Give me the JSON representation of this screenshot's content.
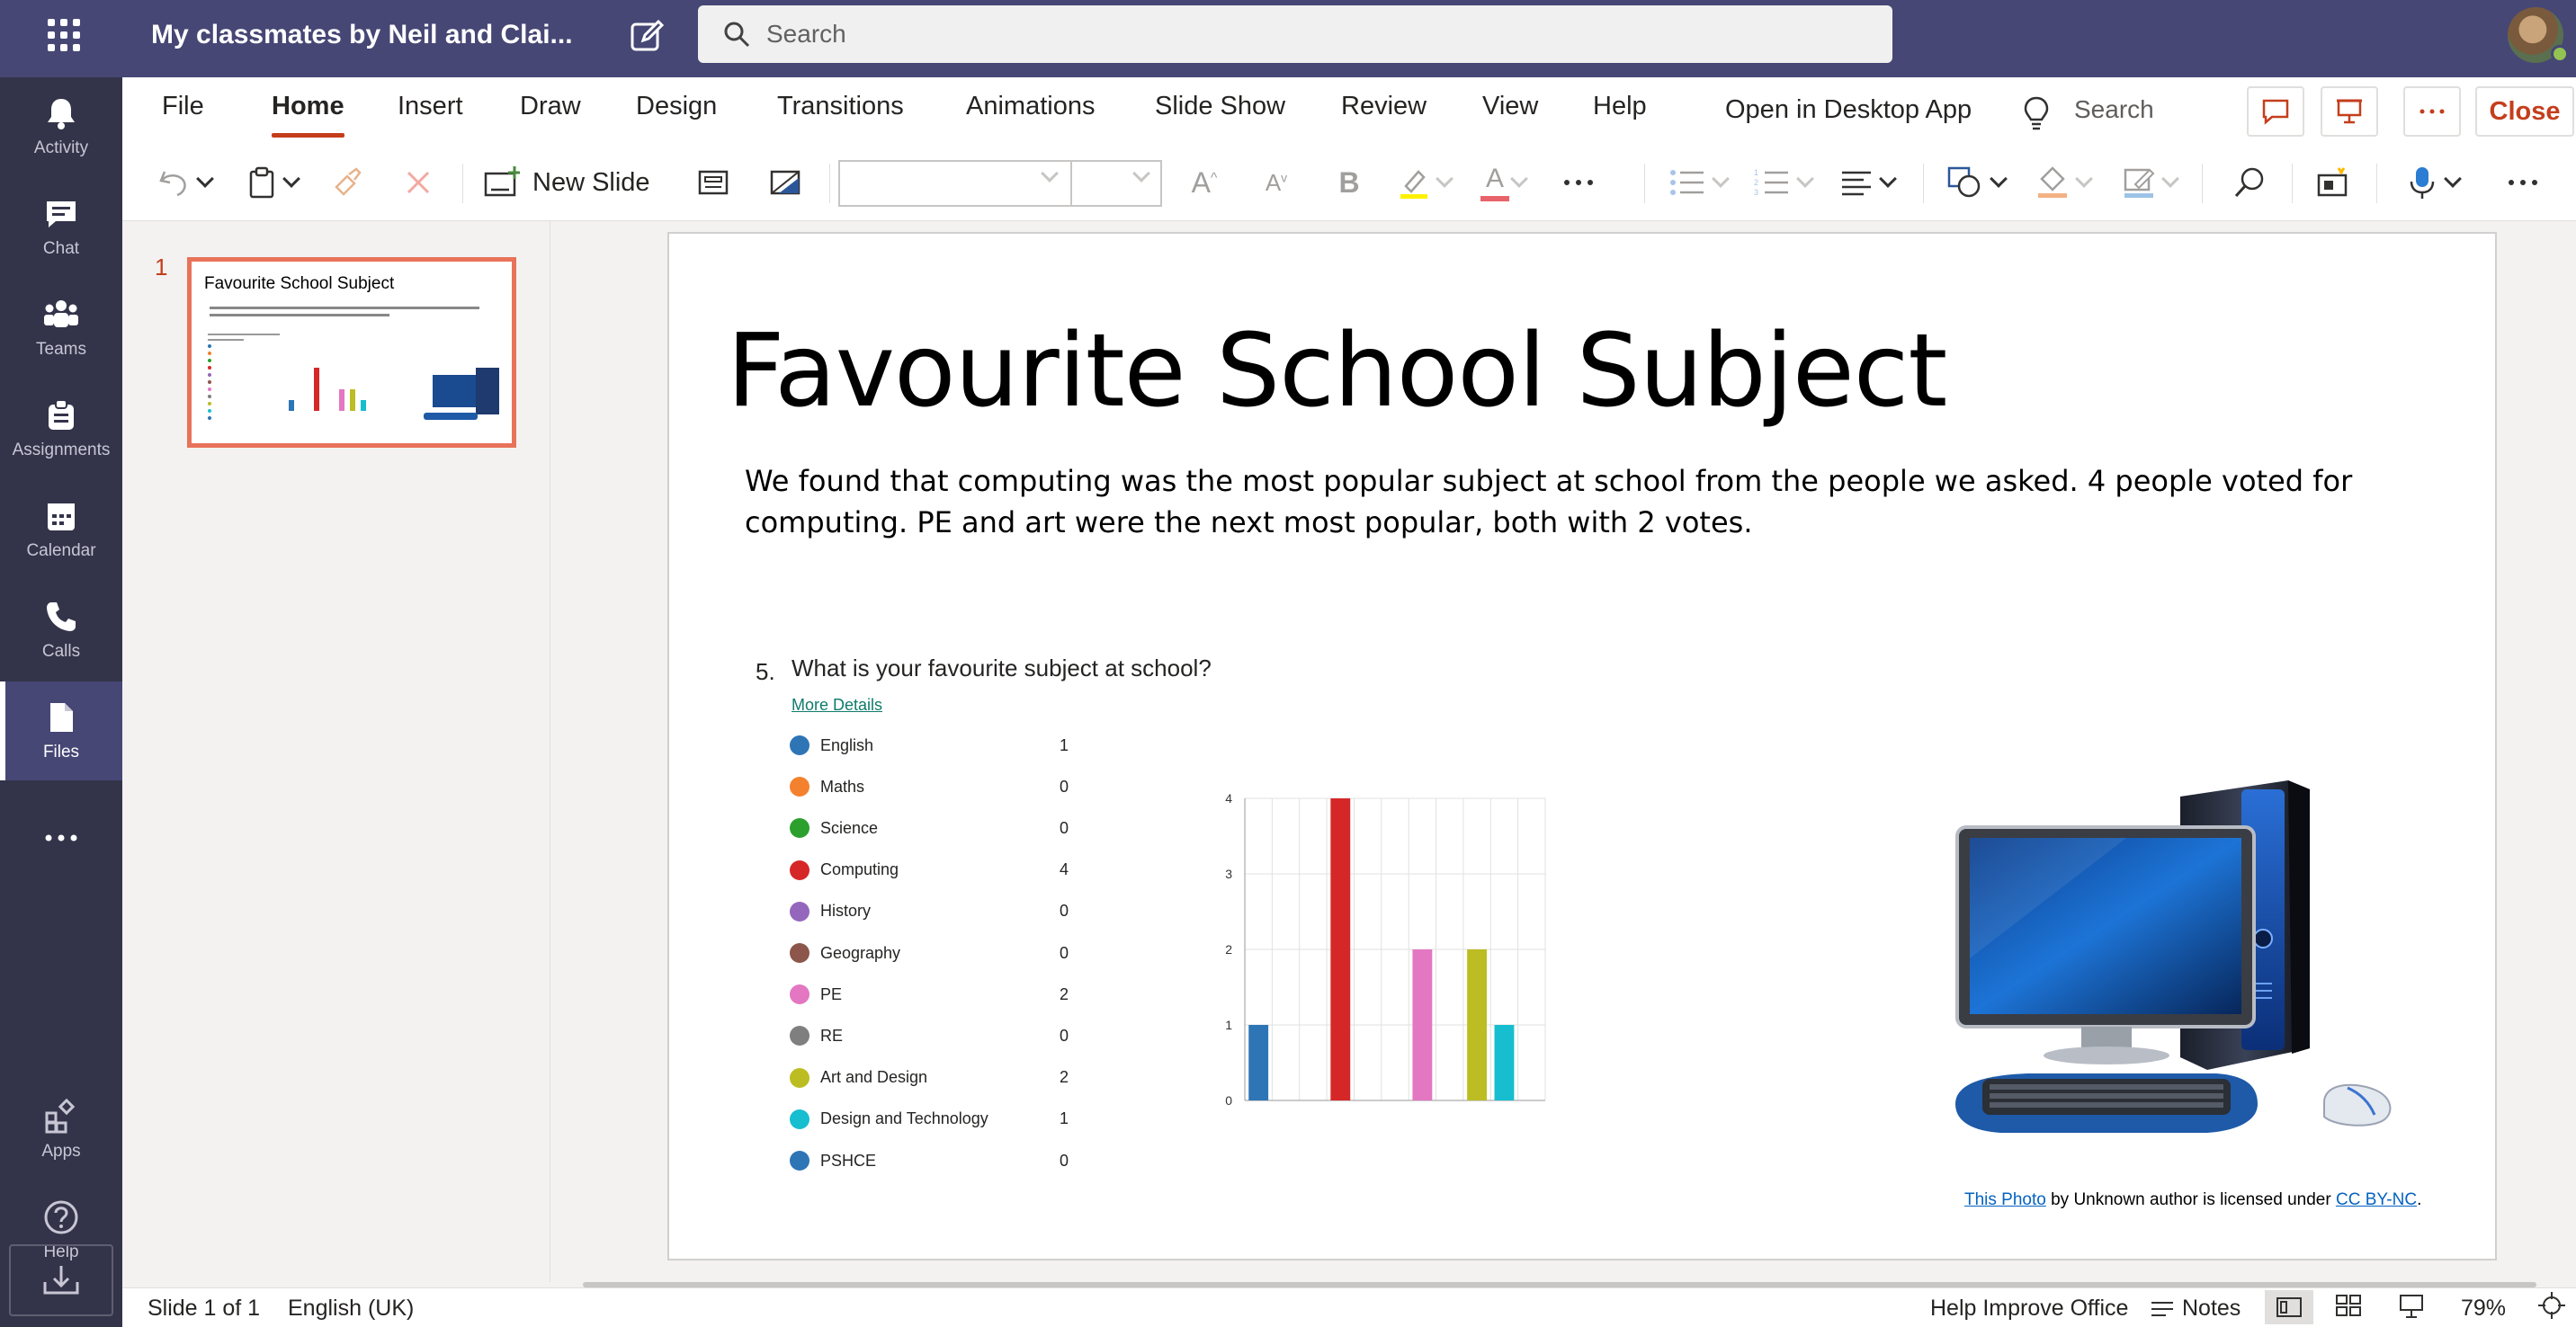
{
  "teams": {
    "title": "My classmates by Neil and Clai...",
    "search_placeholder": "Search",
    "rail": [
      {
        "label": "Activity",
        "icon": "bell-icon"
      },
      {
        "label": "Chat",
        "icon": "chat-icon"
      },
      {
        "label": "Teams",
        "icon": "teams-icon"
      },
      {
        "label": "Assignments",
        "icon": "assignments-icon"
      },
      {
        "label": "Calendar",
        "icon": "calendar-icon"
      },
      {
        "label": "Calls",
        "icon": "phone-icon"
      },
      {
        "label": "Files",
        "icon": "file-icon",
        "active": true
      },
      {
        "label": "Apps",
        "icon": "apps-icon"
      },
      {
        "label": "Help",
        "icon": "help-icon"
      }
    ]
  },
  "ribbon": {
    "tabs": [
      "File",
      "Home",
      "Insert",
      "Draw",
      "Design",
      "Transitions",
      "Animations",
      "Slide Show",
      "Review",
      "View",
      "Help"
    ],
    "active_tab": "Home",
    "open_desktop": "Open in Desktop App",
    "search": "Search",
    "close": "Close",
    "new_slide": "New Slide",
    "accent_color": "#c43e1c"
  },
  "thumbnail": {
    "number": "1",
    "title": "Favourite School Subject"
  },
  "slide": {
    "title": "Favourite School Subject",
    "body": "We found that computing was the most popular subject at school from the people we asked. 4 people voted for computing. PE and art were the next most popular, both with 2 votes.",
    "question_number": "5.",
    "question": "What is your favourite subject at school?",
    "more_details": "More Details",
    "legend": [
      {
        "label": "English",
        "value": "1",
        "color": "#2e75b6"
      },
      {
        "label": "Maths",
        "value": "0",
        "color": "#f4812e"
      },
      {
        "label": "Science",
        "value": "0",
        "color": "#2ca02c"
      },
      {
        "label": "Computing",
        "value": "4",
        "color": "#d62728"
      },
      {
        "label": "History",
        "value": "0",
        "color": "#9467bd"
      },
      {
        "label": "Geography",
        "value": "0",
        "color": "#8c564b"
      },
      {
        "label": "PE",
        "value": "2",
        "color": "#e377c2"
      },
      {
        "label": "RE",
        "value": "0",
        "color": "#7f7f7f"
      },
      {
        "label": "Art and Design",
        "value": "2",
        "color": "#bcbd22"
      },
      {
        "label": "Design and Technology",
        "value": "1",
        "color": "#17becf"
      },
      {
        "label": "PSHCE",
        "value": "0",
        "color": "#2e75b6"
      }
    ],
    "credit": {
      "photo_link": "This Photo",
      "middle": " by Unknown author is licensed under ",
      "license_link": "CC BY-NC",
      "end": "."
    }
  },
  "chart_data": {
    "type": "bar",
    "categories": [
      "English",
      "Maths",
      "Science",
      "Computing",
      "History",
      "Geography",
      "PE",
      "RE",
      "Art and Design",
      "Design and Technology",
      "PSHCE"
    ],
    "values": [
      1,
      0,
      0,
      4,
      0,
      0,
      2,
      0,
      2,
      1,
      0
    ],
    "colors": [
      "#2e75b6",
      "#f4812e",
      "#2ca02c",
      "#d62728",
      "#9467bd",
      "#8c564b",
      "#e377c2",
      "#7f7f7f",
      "#bcbd22",
      "#17becf",
      "#2e75b6"
    ],
    "yticks": [
      "0",
      "1",
      "2",
      "3",
      "4"
    ],
    "ylim": [
      0,
      4
    ],
    "grid": true
  },
  "status": {
    "slide_info": "Slide 1 of 1",
    "language": "English (UK)",
    "help_improve": "Help Improve Office",
    "notes": "Notes",
    "zoom": "79%"
  }
}
